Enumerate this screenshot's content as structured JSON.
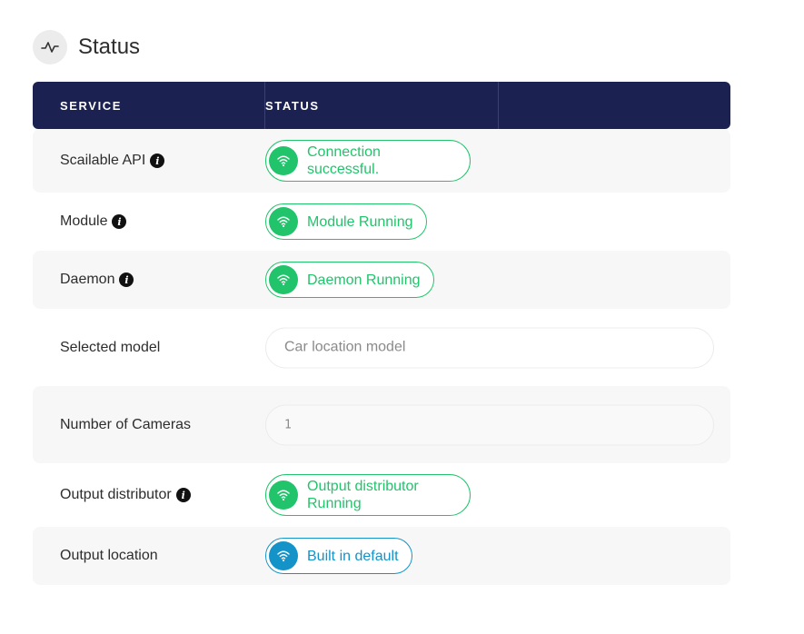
{
  "header": {
    "title": "Status",
    "icon": "activity-icon"
  },
  "table": {
    "columns": [
      "SERVICE",
      "STATUS"
    ],
    "rows": [
      {
        "label": "Scailable API",
        "info": true,
        "status": "Connection successful.",
        "status_lines": [
          "Connection",
          "successful."
        ],
        "color": "#21c46b"
      },
      {
        "label": "Module",
        "info": true,
        "status": "Module Running",
        "color": "#21c46b"
      },
      {
        "label": "Daemon",
        "info": true,
        "status": "Daemon Running",
        "color": "#21c46b"
      },
      {
        "label": "Selected model",
        "info": false,
        "value": "Car location model"
      },
      {
        "label": "Number of Cameras",
        "info": false,
        "value": "1"
      },
      {
        "label": "Output distributor",
        "info": true,
        "status": "Output distributor Running",
        "status_lines": [
          "Output distributor",
          "Running"
        ],
        "color": "#21c46b"
      },
      {
        "label": "Output location",
        "info": false,
        "status": "Built in default",
        "color": "#1493c8"
      }
    ]
  },
  "colors": {
    "header_bg": "#1b2150",
    "success": "#21c46b",
    "info": "#1493c8",
    "row_shade": "#f7f7f7"
  }
}
